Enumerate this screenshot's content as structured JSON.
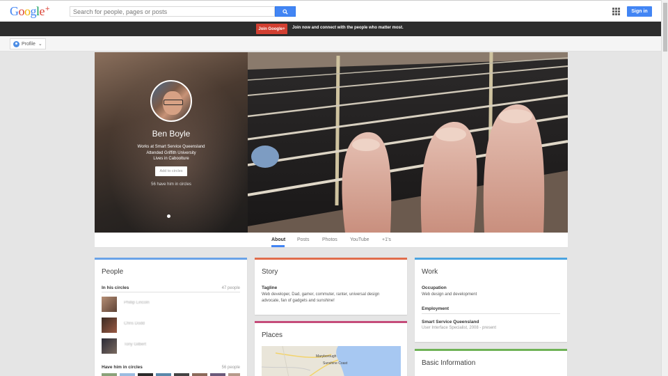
{
  "header": {
    "logo_letters": [
      "G",
      "o",
      "o",
      "g",
      "l",
      "e"
    ],
    "logo_plus": "+",
    "search_placeholder": "Search for people, pages or posts",
    "signin_label": "Sign in",
    "icons": [
      "search-icon",
      "apps-grid-icon"
    ]
  },
  "join_bar": {
    "button_label": "Join Google+",
    "message": "Join now and connect with the people who matter most."
  },
  "profile_bar": {
    "dropdown_label": "Profile"
  },
  "cover": {
    "name": "Ben Boyle",
    "info": [
      "Works at Smart Service Queensland",
      "Attended Griffith University",
      "Lives in Caboolture"
    ],
    "add_button": "Add to circles",
    "circle_count": "56 have him in circles"
  },
  "tabs": [
    "About",
    "Posts",
    "Photos",
    "YouTube",
    "+1's"
  ],
  "active_tab": "About",
  "people": {
    "title": "People",
    "in_circles_label": "In his circles",
    "in_circles_count": "47 people",
    "persons": [
      "Phillip Lincoln",
      "Chris Dodd",
      "Tony Gilbert"
    ],
    "have_him_label": "Have him in circles",
    "have_him_count": "56 people"
  },
  "story": {
    "title": "Story",
    "tagline_label": "Tagline",
    "tagline": "Web developer, Dad, gamer, commuter, ranter, universal design advocate, fan of gadgets and sunshine!"
  },
  "places": {
    "title": "Places",
    "map_labels": [
      "Maryborough",
      "Sunshine Coast"
    ]
  },
  "work": {
    "title": "Work",
    "occupation_label": "Occupation",
    "occupation": "Web design and development",
    "employment_label": "Employment",
    "employer": "Smart Service Queensland",
    "position": "User Interface Specialist, 2008 - present"
  },
  "basic": {
    "title": "Basic Information"
  },
  "colors": {
    "blue": "#4285f4",
    "red": "#d23f31",
    "green": "#6fb256",
    "people_border": "#6aa3e8",
    "story_border": "#e06c4b",
    "places_border": "#c54c7a",
    "work_border": "#4aa4e0",
    "basic_border": "#6fb256"
  }
}
